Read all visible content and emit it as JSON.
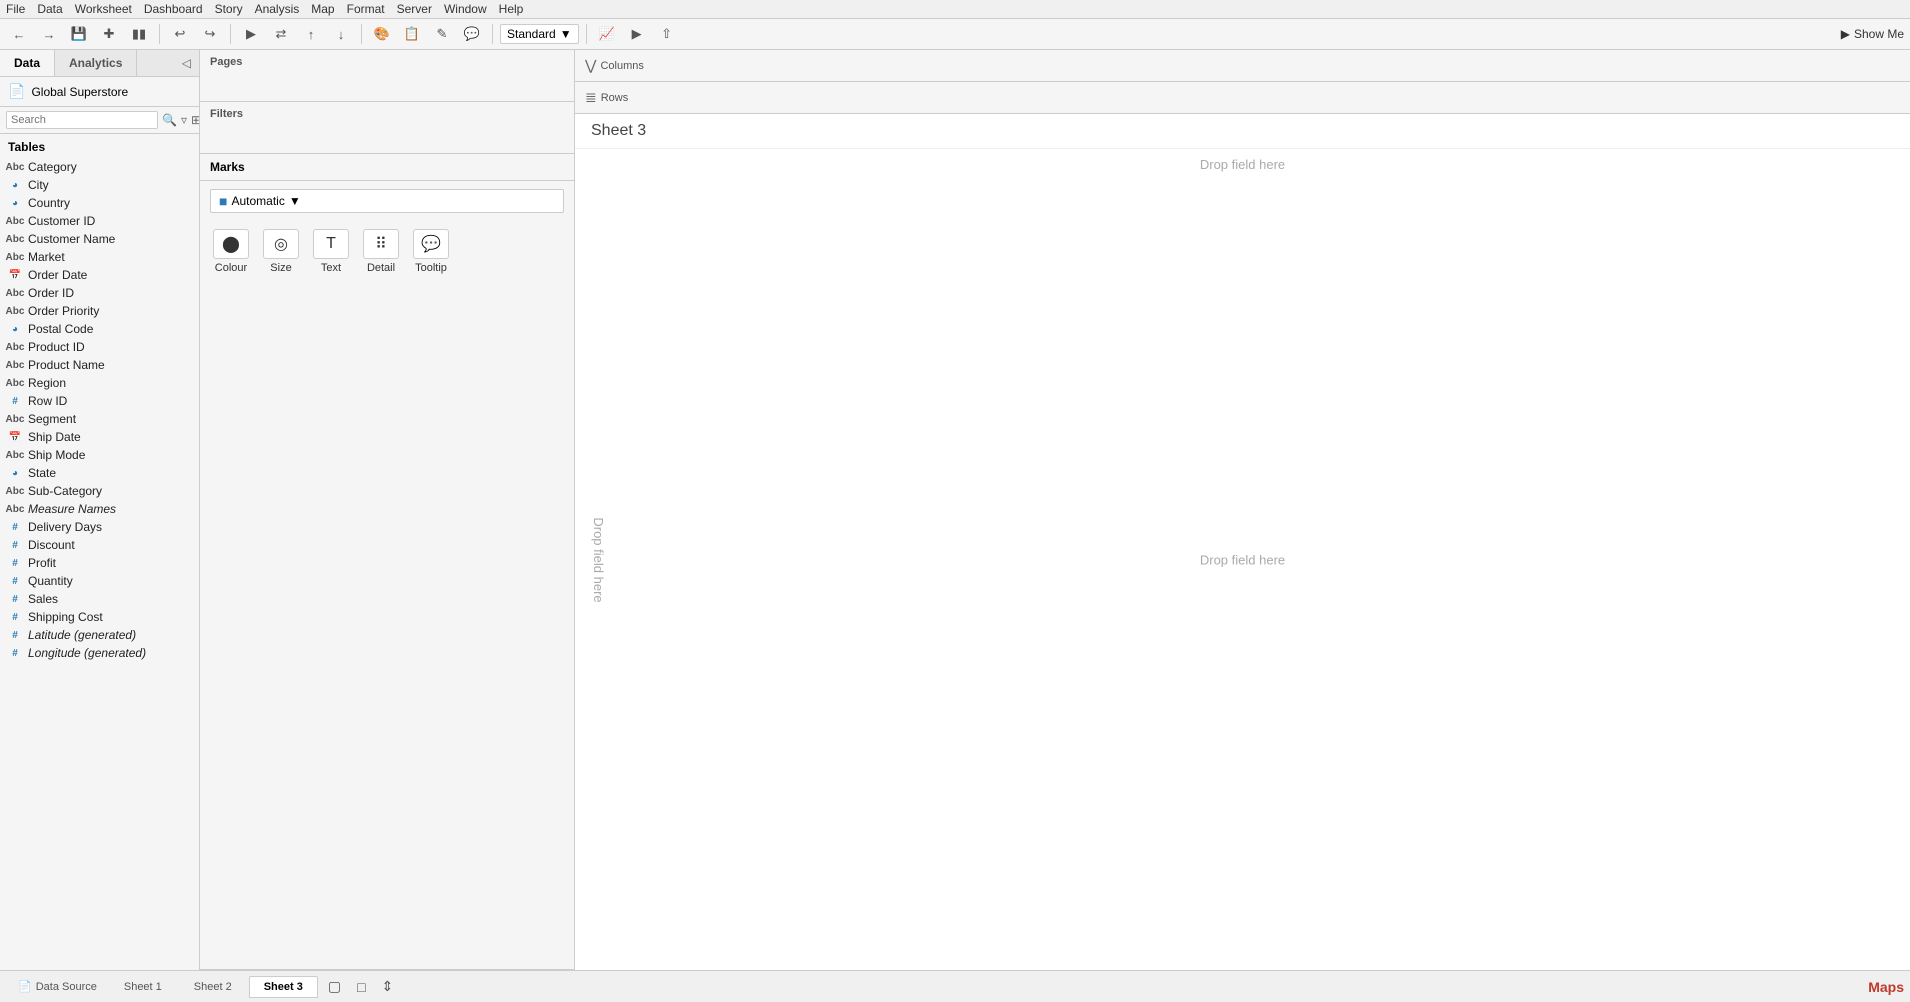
{
  "menubar": {
    "items": [
      "File",
      "Data",
      "Worksheet",
      "Dashboard",
      "Story",
      "Analysis",
      "Map",
      "Format",
      "Server",
      "Window",
      "Help"
    ]
  },
  "toolbar": {
    "standard_label": "Standard",
    "show_me_label": "Show Me"
  },
  "left_panel": {
    "tab_data": "Data",
    "tab_analytics": "Analytics",
    "datasource": "Global Superstore",
    "search_placeholder": "Search",
    "tables_label": "Tables",
    "fields": [
      {
        "name": "Category",
        "type": "abc"
      },
      {
        "name": "City",
        "type": "geo"
      },
      {
        "name": "Country",
        "type": "geo"
      },
      {
        "name": "Customer ID",
        "type": "abc"
      },
      {
        "name": "Customer Name",
        "type": "abc"
      },
      {
        "name": "Market",
        "type": "abc"
      },
      {
        "name": "Order Date",
        "type": "date"
      },
      {
        "name": "Order ID",
        "type": "abc"
      },
      {
        "name": "Order Priority",
        "type": "abc"
      },
      {
        "name": "Postal Code",
        "type": "geo"
      },
      {
        "name": "Product ID",
        "type": "abc"
      },
      {
        "name": "Product Name",
        "type": "abc"
      },
      {
        "name": "Region",
        "type": "abc"
      },
      {
        "name": "Row ID",
        "type": "num"
      },
      {
        "name": "Segment",
        "type": "abc"
      },
      {
        "name": "Ship Date",
        "type": "date"
      },
      {
        "name": "Ship Mode",
        "type": "abc"
      },
      {
        "name": "State",
        "type": "geo"
      },
      {
        "name": "Sub-Category",
        "type": "abc"
      },
      {
        "name": "Measure Names",
        "type": "measure-names",
        "italic": true
      },
      {
        "name": "Delivery Days",
        "type": "num"
      },
      {
        "name": "Discount",
        "type": "num"
      },
      {
        "name": "Profit",
        "type": "num"
      },
      {
        "name": "Quantity",
        "type": "num"
      },
      {
        "name": "Sales",
        "type": "num"
      },
      {
        "name": "Shipping Cost",
        "type": "num"
      },
      {
        "name": "Latitude (generated)",
        "type": "num",
        "italic": true
      },
      {
        "name": "Longitude (generated)",
        "type": "num",
        "italic": true
      }
    ]
  },
  "shelf_panel": {
    "pages_label": "Pages",
    "filters_label": "Filters",
    "marks_label": "Marks",
    "marks_type": "Automatic",
    "marks_buttons": [
      {
        "name": "Colour",
        "icon": "⬤"
      },
      {
        "name": "Size",
        "icon": "◎"
      },
      {
        "name": "Text",
        "icon": "T"
      },
      {
        "name": "Detail",
        "icon": "⠿"
      },
      {
        "name": "Tooltip",
        "icon": "💬"
      }
    ]
  },
  "sheet": {
    "columns_label": "Columns",
    "rows_label": "Rows",
    "title": "Sheet 3",
    "drop_field_here_top": "Drop field here",
    "drop_field_here_center": "Drop field here",
    "drop_field_left": "Drop field here"
  },
  "bottom_bar": {
    "datasource_tab": "Data Source",
    "sheet1_tab": "Sheet 1",
    "sheet2_tab": "Sheet 2",
    "sheet3_tab": "Sheet 3",
    "maps_label": "Maps"
  }
}
